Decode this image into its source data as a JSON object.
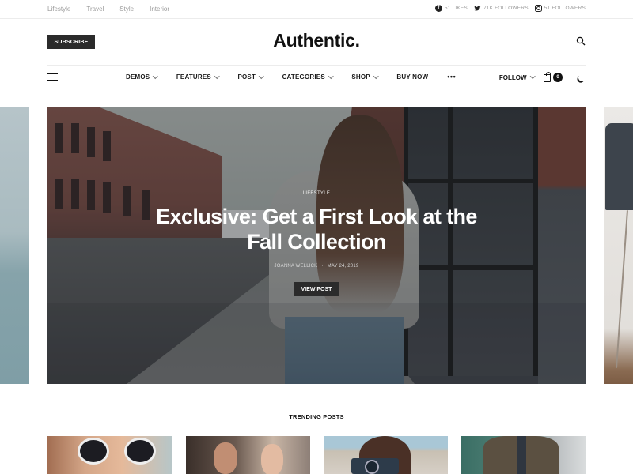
{
  "topbar": {
    "categories": [
      "Lifestyle",
      "Travel",
      "Style",
      "Interior"
    ],
    "social": [
      {
        "icon": "facebook-icon",
        "label": "51 LIKES"
      },
      {
        "icon": "twitter-icon",
        "label": "71K FOLLOWERS"
      },
      {
        "icon": "instagram-icon",
        "label": "51 FOLLOWERS"
      }
    ]
  },
  "header": {
    "subscribe_label": "SUBSCRIBE",
    "logo": "Authentic."
  },
  "nav": {
    "items": [
      {
        "label": "DEMOS",
        "dropdown": true
      },
      {
        "label": "FEATURES",
        "dropdown": true
      },
      {
        "label": "POST",
        "dropdown": true
      },
      {
        "label": "CATEGORIES",
        "dropdown": true
      },
      {
        "label": "SHOP",
        "dropdown": true
      },
      {
        "label": "BUY NOW",
        "dropdown": false
      },
      {
        "label": "•••",
        "dropdown": false
      }
    ],
    "follow_label": "FOLLOW",
    "cart_count": "0"
  },
  "hero": {
    "category": "LIFESTYLE",
    "title": "Exclusive: Get a First Look at the Fall Collection",
    "author": "JOANNA WELLICK",
    "separator": "·",
    "date": "MAY 24, 2019",
    "button_label": "VIEW POST"
  },
  "trending": {
    "title": "TRENDING POSTS"
  }
}
